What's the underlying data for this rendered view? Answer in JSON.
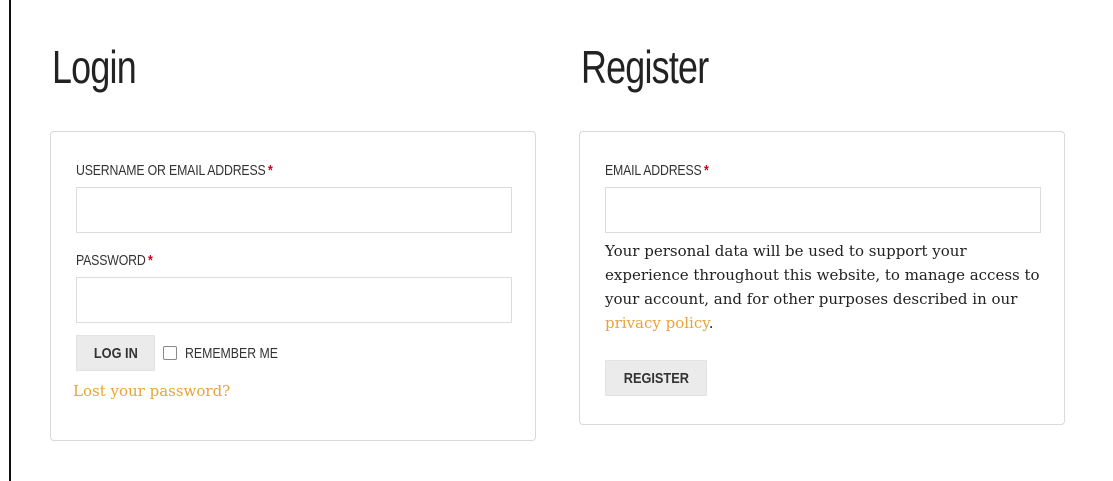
{
  "login": {
    "heading": "Login",
    "username_label": "Username or email address",
    "username_value": "",
    "password_label": "Password",
    "password_value": "",
    "required_mark": "*",
    "login_button": "Log in",
    "remember_me_label": "Remember me",
    "remember_me_checked": false,
    "lost_password_link": "Lost your password?"
  },
  "register": {
    "heading": "Register",
    "email_label": "Email address",
    "email_value": "",
    "required_mark": "*",
    "privacy_text": "Your personal data will be used to support your experience throughout this website, to manage access to your account, and for other purposes described in our",
    "privacy_link": "privacy policy",
    "privacy_suffix": ".",
    "register_button": "Register"
  },
  "colors": {
    "accent_link": "#e8a33a",
    "required": "#d0021b",
    "button_bg": "#ecebec"
  }
}
